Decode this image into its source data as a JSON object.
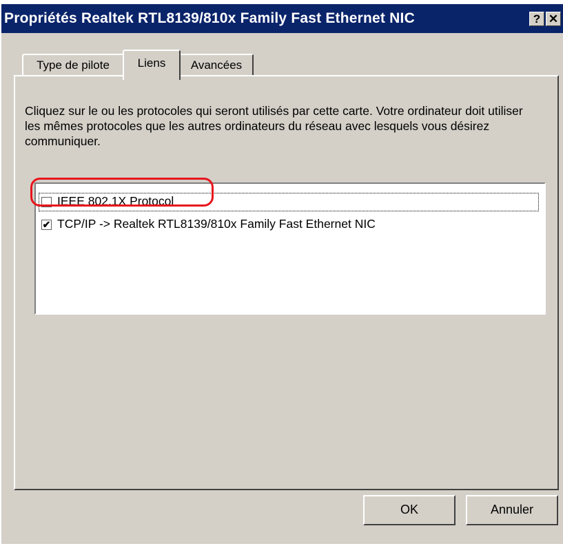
{
  "window": {
    "title": "Propriétés Realtek RTL8139/810x Family Fast Ethernet NIC",
    "help_button": "?",
    "close_button": "✕"
  },
  "tabs": [
    {
      "label": "Type de pilote",
      "active": false
    },
    {
      "label": "Liens",
      "active": true
    },
    {
      "label": "Avancées",
      "active": false
    }
  ],
  "description": "Cliquez sur le ou les protocoles qui seront utilisés par cette carte. Votre ordinateur doit utiliser les mêmes protocoles que les autres ordinateurs du réseau avec lesquels vous désirez communiquer.",
  "protocols": [
    {
      "label": "IEEE 802.1X Protocol",
      "checked": false,
      "check_mark": ""
    },
    {
      "label": "TCP/IP -> Realtek RTL8139/810x Family Fast Ethernet NIC",
      "checked": true,
      "check_mark": "✔"
    }
  ],
  "buttons": {
    "ok": "OK",
    "cancel": "Annuler"
  },
  "colors": {
    "titlebar": "#0a246a",
    "dialog_face": "#d4d0c8",
    "highlight_annotation": "#e8141c"
  }
}
